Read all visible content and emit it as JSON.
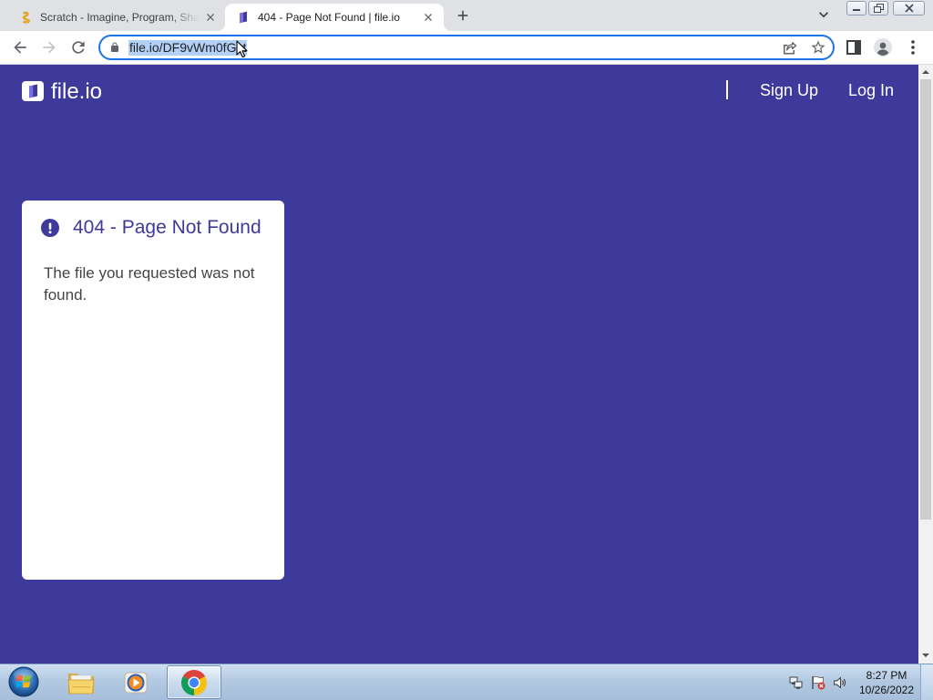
{
  "browser": {
    "tabs": [
      {
        "title": "Scratch - Imagine, Program, Shar",
        "favicon": "scratch-favicon-icon"
      },
      {
        "title": "404 - Page Not Found | file.io",
        "favicon": "fileio-favicon-icon"
      }
    ],
    "tab_strip_icons": [
      "new-tab-plus-icon",
      "tab-search-chevron-icon",
      "minimize-icon",
      "restore-icon",
      "close-window-icon"
    ],
    "toolbar_icons": [
      "back-arrow-icon",
      "forward-arrow-icon",
      "reload-icon",
      "lock-icon",
      "share-icon",
      "star-icon",
      "side-panel-icon",
      "profile-icon",
      "menu-icon"
    ],
    "address": {
      "url": "file.io/DF9vWm0fGst"
    }
  },
  "page": {
    "brand": "file.io",
    "brand_icon": "fileio-logo-icon",
    "nav": {
      "sign_up": "Sign Up",
      "log_in": "Log In"
    },
    "error_card": {
      "icon": "alert-circle-icon",
      "title": "404 - Page Not Found",
      "message": "The file you requested was not found."
    }
  },
  "taskbar": {
    "pinned": [
      "windows-start-icon",
      "windows-explorer-icon",
      "windows-media-player-icon",
      "chrome-icon"
    ],
    "tray": [
      "network-icon",
      "action-center-flag-icon",
      "volume-icon"
    ],
    "clock": {
      "time": "8:27 PM",
      "date": "10/26/2022"
    }
  },
  "colors": {
    "page_background": "#3e3a9c",
    "focus_ring": "#1a73e8",
    "selection": "#b3d0f7",
    "card_text": "#444444"
  }
}
